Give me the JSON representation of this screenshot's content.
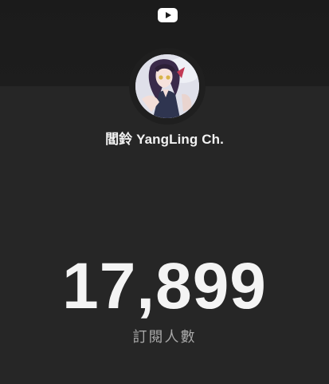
{
  "channel": {
    "name": "閻鈴 YangLing Ch.",
    "avatar": "channel-avatar-anime-girl"
  },
  "subscribers": {
    "count": "17,899",
    "label": "訂閱人數"
  },
  "icons": {
    "platform": "youtube-icon"
  },
  "colors": {
    "background": "#262626",
    "top_band": "#1c1c1c",
    "youtube_logo": "#ffffff",
    "count_text": "#f4f4f4",
    "label_text": "#a8a8a8"
  }
}
